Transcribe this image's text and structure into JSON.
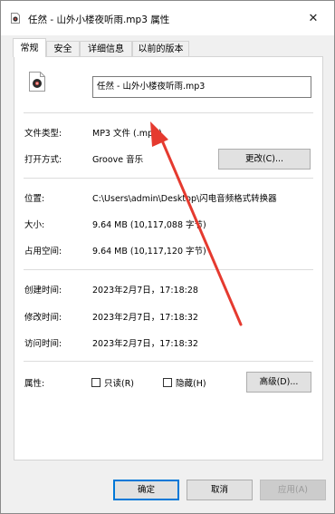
{
  "window": {
    "title": "任然 - 山外小楼夜听雨.mp3 属性",
    "close_glyph": "✕"
  },
  "tabs": [
    {
      "label": "常规",
      "active": true
    },
    {
      "label": "安全",
      "active": false
    },
    {
      "label": "详细信息",
      "active": false
    },
    {
      "label": "以前的版本",
      "active": false
    }
  ],
  "file": {
    "name": "任然 - 山外小楼夜听雨.mp3"
  },
  "type": {
    "label": "文件类型:",
    "value": "MP3 文件 (.mp3)"
  },
  "open_with": {
    "label": "打开方式:",
    "value": "Groove 音乐",
    "change_button": "更改(C)..."
  },
  "location": {
    "label": "位置:",
    "value": "C:\\Users\\admin\\Desktop\\闪电音频格式转换器"
  },
  "size": {
    "label": "大小:",
    "value": "9.64 MB (10,117,088 字节)"
  },
  "size_on_disk": {
    "label": "占用空间:",
    "value": "9.64 MB (10,117,120 字节)"
  },
  "created": {
    "label": "创建时间:",
    "value": "2023年2月7日，17:18:28"
  },
  "modified": {
    "label": "修改时间:",
    "value": "2023年2月7日，17:18:32"
  },
  "accessed": {
    "label": "访问时间:",
    "value": "2023年2月7日，17:18:32"
  },
  "attributes": {
    "label": "属性:",
    "readonly_label": "只读(R)",
    "hidden_label": "隐藏(H)",
    "advanced_button": "高级(D)..."
  },
  "footer": {
    "ok": "确定",
    "cancel": "取消",
    "apply": "应用(A)"
  },
  "colors": {
    "annotation_arrow": "#e53a2f",
    "focus_border": "#0078d7"
  }
}
